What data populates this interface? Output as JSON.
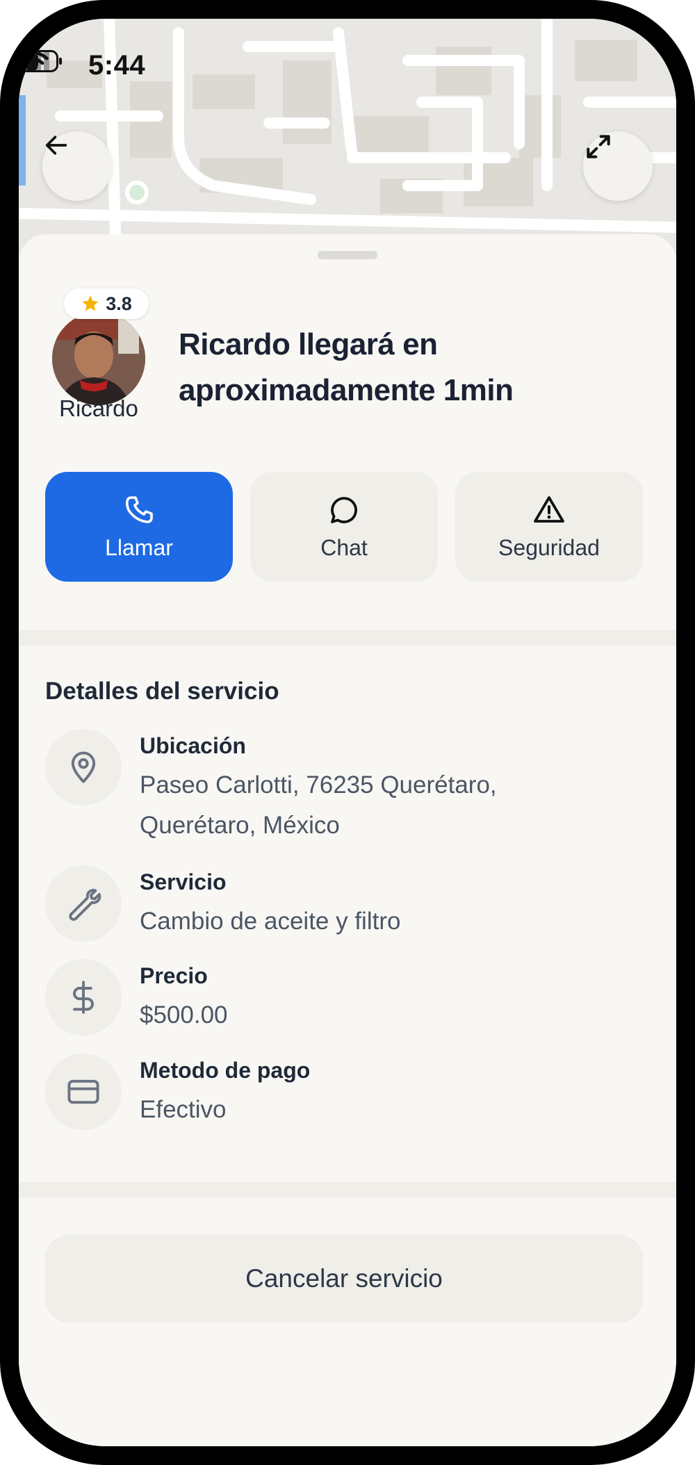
{
  "status_bar": {
    "time": "5:44"
  },
  "map": {
    "back_icon": "arrow-left-icon",
    "expand_icon": "expand-icon"
  },
  "driver": {
    "name": "Ricardo",
    "rating": "3.8",
    "headline": "Ricardo llegará en aproximadamente 1min"
  },
  "actions": [
    {
      "label": "Llamar",
      "icon": "phone-icon"
    },
    {
      "label": "Chat",
      "icon": "chat-icon"
    },
    {
      "label": "Seguridad",
      "icon": "warning-icon"
    }
  ],
  "details": {
    "title": "Detalles del servicio",
    "items": [
      {
        "label": "Ubicación",
        "value": "Paseo Carlotti, 76235 Querétaro, Querétaro, México",
        "icon": "location-pin-icon"
      },
      {
        "label": "Servicio",
        "value": "Cambio de aceite y filtro",
        "icon": "wrench-icon"
      },
      {
        "label": "Precio",
        "value": "$500.00",
        "icon": "dollar-icon"
      },
      {
        "label": "Metodo de pago",
        "value": "Efectivo",
        "icon": "credit-card-icon"
      }
    ]
  },
  "cancel_label": "Cancelar servicio",
  "colors": {
    "primary": "#1d6ae4",
    "star": "#f5b301",
    "surface": "#f8f7f4",
    "chip": "#efeee8"
  }
}
